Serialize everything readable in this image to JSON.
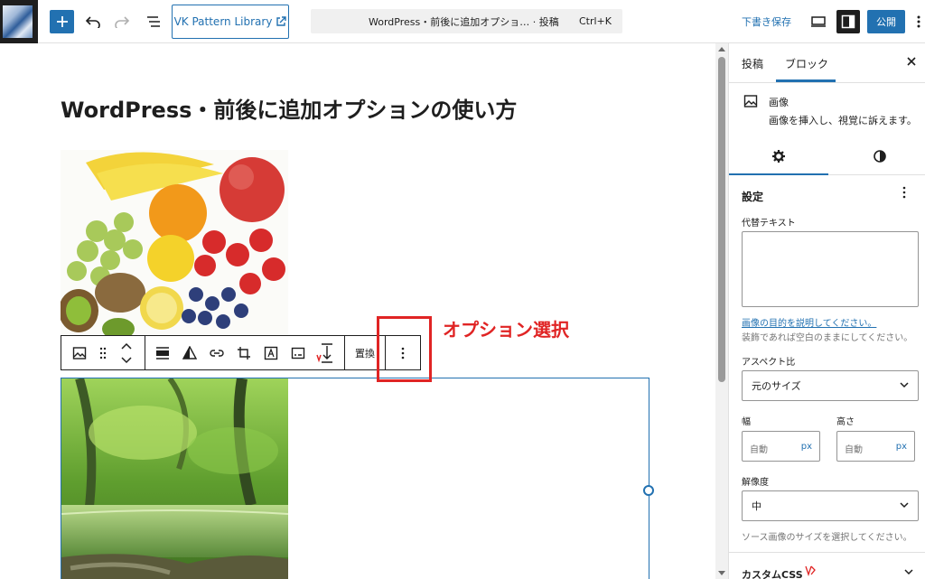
{
  "topbar": {
    "site_icon": "site-icon-image",
    "add_icon": "plus-icon",
    "undo_icon": "undo-icon",
    "redo_icon": "redo-icon",
    "outline_icon": "list-view-icon",
    "pattern_library_label": "VK Pattern Library",
    "pattern_library_icon": "external-link-icon",
    "command_title": "WordPress・前後に追加オプショ… · 投稿",
    "command_shortcut": "Ctrl+K",
    "save_draft_label": "下書き保存",
    "view_icon": "desktop-view-icon",
    "settings_icon": "sidebar-settings-icon",
    "publish_label": "公開",
    "options_icon": "more-vertical-icon"
  },
  "canvas": {
    "post_title": "WordPress・前後に追加オプションの使い方",
    "image1": "fruits-photo",
    "image2": "forest-river-photo"
  },
  "block_toolbar": {
    "icons": [
      "image-icon",
      "drag-handle-icon",
      "move-up-down-icon",
      "align-icon",
      "duotone-icon",
      "link-icon",
      "crop-icon",
      "text-overlay-icon",
      "caption-icon",
      "vk-insert-icon"
    ],
    "replace_label": "置換",
    "options_icon": "more-vertical-icon"
  },
  "annotation": {
    "label": "オプション選択",
    "color": "#e02424"
  },
  "sidebar": {
    "tab_post": "投稿",
    "tab_block": "ブロック",
    "close_icon": "close-icon",
    "block_name": "画像",
    "block_desc": "画像を挿入し、視覚に訴えます。",
    "subtab_settings_icon": "gear-icon",
    "subtab_styles_icon": "half-circle-icon",
    "panel_title": "設定",
    "alt_label": "代替テキスト",
    "alt_value": "",
    "alt_link": "画像の目的を説明してください。",
    "alt_help": "装飾であれば空白のままにしてください。",
    "aspect_label": "アスペクト比",
    "aspect_value": "元のサイズ",
    "width_label": "幅",
    "width_placeholder": "自動",
    "width_unit": "px",
    "height_label": "高さ",
    "height_placeholder": "自動",
    "height_unit": "px",
    "resolution_label": "解像度",
    "resolution_value": "中",
    "resolution_help": "ソース画像のサイズを選択してください。",
    "custom_css_label": "カスタムCSS"
  },
  "colors": {
    "accent": "#2271b1",
    "highlight": "#e02424"
  }
}
